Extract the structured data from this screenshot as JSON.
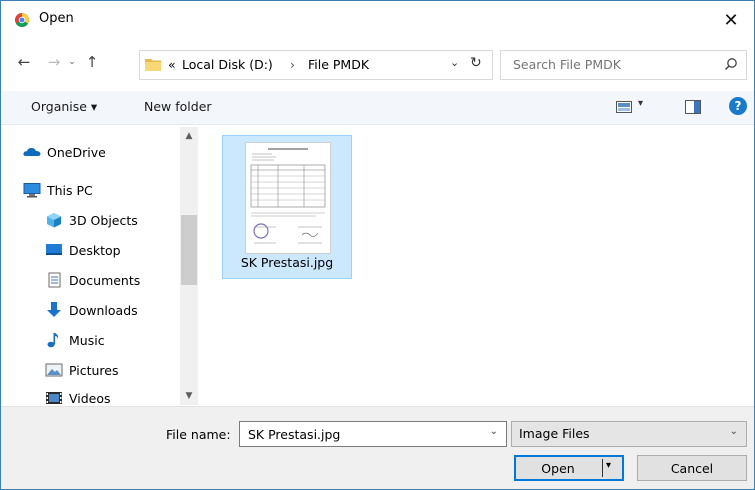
{
  "window": {
    "title": "Open",
    "close_glyph": "✕"
  },
  "nav": {
    "back": "←",
    "forward": "→",
    "recent": "⌄",
    "up": "↑"
  },
  "address": {
    "overflow": "«",
    "crumbs": [
      "Local Disk (D:)",
      "File PMDK"
    ],
    "separator": "›",
    "dropdown": "⌄",
    "refresh": "↻"
  },
  "search": {
    "placeholder": "Search File PMDK"
  },
  "toolbar": {
    "organise_label": "Organise ▾",
    "new_folder_label": "New folder",
    "view_dropdown": "▾",
    "help_label": "?"
  },
  "sidebar": {
    "items": [
      {
        "label": "OneDrive",
        "icon": "onedrive-icon"
      },
      {
        "label": "This PC",
        "icon": "pc-icon"
      },
      {
        "label": "3D Objects",
        "icon": "3d-objects-icon"
      },
      {
        "label": "Desktop",
        "icon": "desktop-icon"
      },
      {
        "label": "Documents",
        "icon": "documents-icon"
      },
      {
        "label": "Downloads",
        "icon": "downloads-icon"
      },
      {
        "label": "Music",
        "icon": "music-icon"
      },
      {
        "label": "Pictures",
        "icon": "pictures-icon"
      },
      {
        "label": "Videos",
        "icon": "videos-icon"
      }
    ],
    "scroll_up": "▲",
    "scroll_down": "▼"
  },
  "files": [
    {
      "name": "SK Prestasi.jpg",
      "selected": true
    }
  ],
  "footer": {
    "file_name_label": "File name:",
    "file_name_value": "SK Prestasi.jpg",
    "file_name_dropdown": "⌄",
    "file_type": "Image Files",
    "file_type_dropdown": "⌄",
    "open_label": "Open",
    "open_dropdown": "▾",
    "cancel_label": "Cancel"
  },
  "colors": {
    "accent": "#0078d7",
    "selection_bg": "#cce8ff",
    "selection_border": "#99d1ff",
    "toolbar_bg": "#f3f6fb",
    "footer_bg": "#f0f0f0",
    "help_blue": "#1979ca"
  }
}
